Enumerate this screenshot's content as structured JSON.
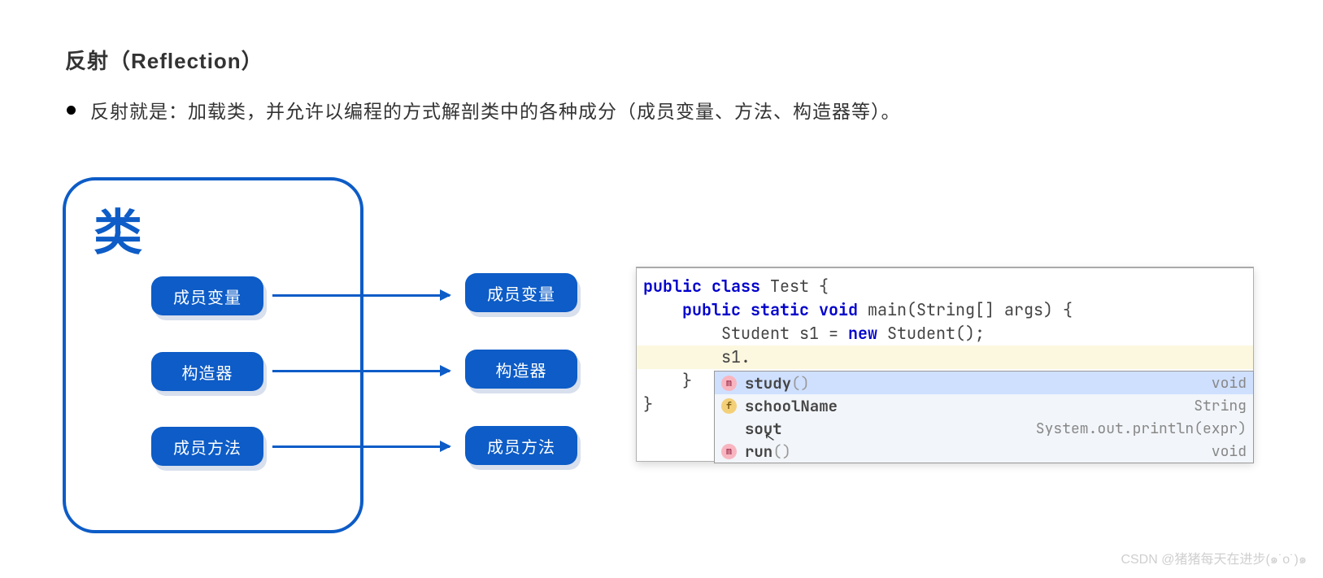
{
  "title": "反射（Reflection）",
  "bullet": "反射就是：加载类，并允许以编程的方式解剖类中的各种成分（成员变量、方法、构造器等）。",
  "class_label": "类",
  "left_pills": [
    "成员变量",
    "构造器",
    "成员方法"
  ],
  "right_pills": [
    "成员变量",
    "构造器",
    "成员方法"
  ],
  "code": {
    "l1_kw1": "public",
    "l1_kw2": "class",
    "l1_rest": " Test {",
    "l2_kw1": "public",
    "l2_kw2": "static",
    "l2_kw3": "void",
    "l2_rest": " main(String[] args) {",
    "l3_a": "Student s1 = ",
    "l3_kw": "new",
    "l3_b": " Student();",
    "l4": "s1.",
    "l5": "}",
    "l6": "}"
  },
  "popup": [
    {
      "icon": "m",
      "name": "study",
      "paren": "()",
      "right": "void",
      "selected": true
    },
    {
      "icon": "f",
      "name": "schoolName",
      "paren": "",
      "right": "String",
      "selected": false
    },
    {
      "icon": "",
      "name": "sout",
      "paren": "",
      "right": "System.out.println(expr)",
      "selected": false
    },
    {
      "icon": "m",
      "name": "run",
      "paren": "()",
      "right": "void",
      "selected": false
    }
  ],
  "watermark": "CSDN @猪猪每天在进步(๑˙o˙)๑"
}
